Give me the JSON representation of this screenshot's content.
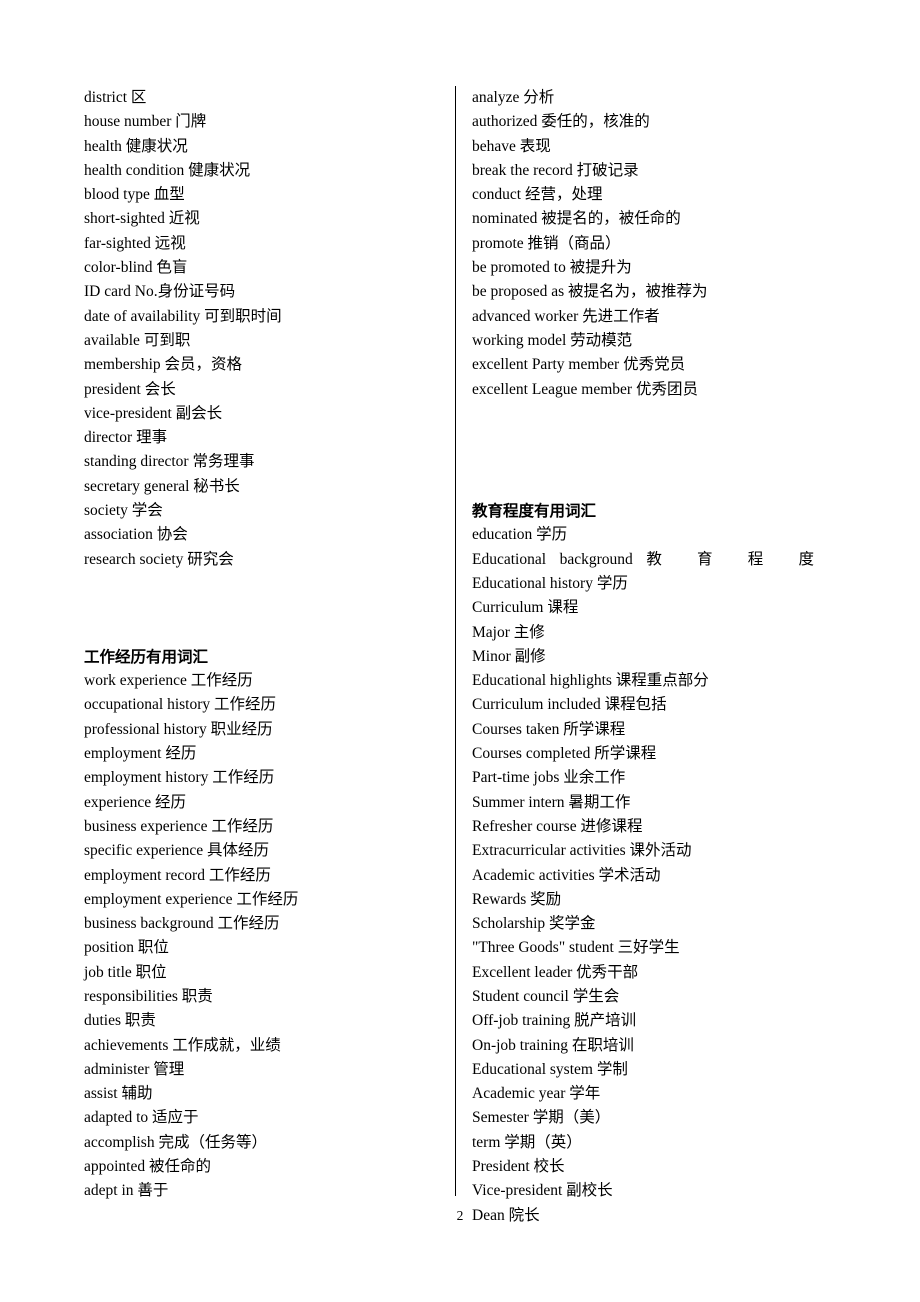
{
  "document": {
    "page_number": "2"
  },
  "left_column": {
    "entries_block_1": [
      "district 区",
      "house number  门牌",
      "health  健康状况",
      "health condition  健康状况",
      "blood type  血型",
      "short-sighted  近视",
      "far-sighted  远视",
      "color-blind  色盲",
      "ID card No.身份证号码",
      "date of availability  可到职时间",
      "available  可到职",
      "membership  会员，资格",
      "president  会长",
      "vice-president  副会长",
      "director  理事",
      "standing director  常务理事",
      "secretary general  秘书长",
      "society 学会",
      "association  协会",
      "research society  研究会"
    ],
    "section_heading": "工作经历有用词汇",
    "entries_block_2": [
      "work experience 工作经历",
      "occupational history 工作经历",
      "professional history 职业经历",
      "employment 经历",
      "employment history 工作经历",
      "experience 经历",
      "business experience 工作经历",
      "specific experience 具体经历",
      "employment record 工作经历",
      "employment experience 工作经历",
      "business background 工作经历",
      "position 职位",
      "job title 职位",
      "responsibilities 职责",
      "duties 职责",
      "achievements 工作成就，业绩",
      "administer 管理",
      "assist 辅助",
      "adapted to 适应于",
      "accomplish 完成（任务等）",
      "appointed 被任命的",
      "adept in 善于"
    ]
  },
  "right_column": {
    "entries_block_1": [
      "analyze 分析",
      "authorized 委任的，核准的",
      "behave 表现",
      "break the record 打破记录",
      "conduct 经营，处理",
      "nominated 被提名的，被任命的",
      "promote 推销（商品）",
      "be promoted to 被提升为",
      "be proposed as 被提名为，被推荐为",
      "advanced worker 先进工作者",
      "working model 劳动模范",
      "excellent Party member 优秀党员",
      "excellent League member 优秀团员"
    ],
    "section_heading": "教育程度有用词汇",
    "entries_block_2_first": "education 学历",
    "justified_entry": {
      "part1": "Educational",
      "part2": "background",
      "part3": "教 育 程 度",
      "part4": "Educational",
      "part5": "history",
      "part6": "学历"
    },
    "entries_block_2": [
      "Curriculum  课程",
      "Major  主修",
      "Minor  副修",
      "Educational highlights  课程重点部分",
      "Curriculum included 课程包括",
      "Courses taken  所学课程",
      "Courses completed  所学课程",
      "Part-time jobs  业余工作",
      "Summer intern  暑期工作",
      "Refresher course  进修课程",
      "Extracurricular activities 课外活动",
      "Academic activities  学术活动",
      "Rewards  奖励",
      "Scholarship  奖学金",
      "\"Three Goods\" student 三好学生",
      "Excellent leader  优秀干部",
      "Student council  学生会",
      "Off-job training  脱产培训",
      "On-job training 在职培训",
      "Educational system  学制",
      "Academic year  学年",
      "Semester  学期（美）",
      "term 学期（英）",
      "President  校长",
      "Vice-president  副校长",
      "Dean  院长"
    ]
  }
}
